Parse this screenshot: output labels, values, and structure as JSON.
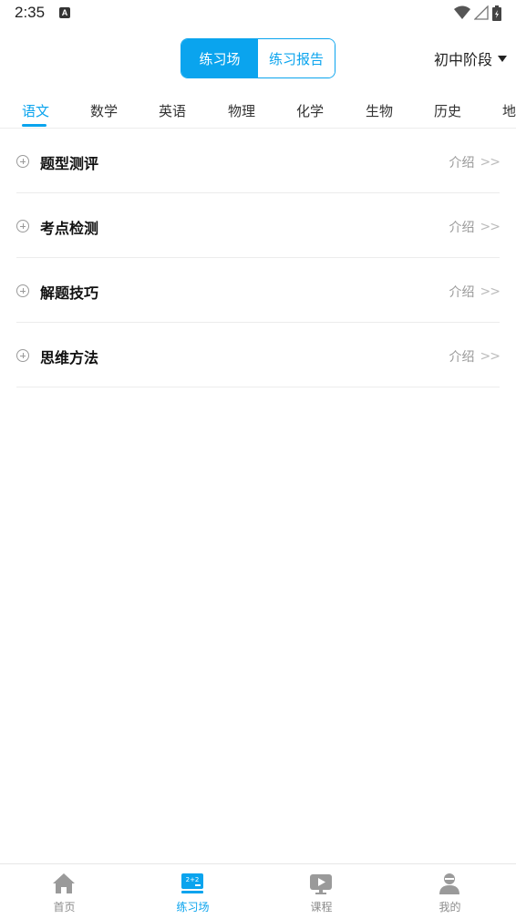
{
  "status": {
    "time": "2:35",
    "indicator": "A"
  },
  "header": {
    "segments": [
      "练习场",
      "练习报告"
    ],
    "active_segment": "练习场",
    "stage_selector": "初中阶段",
    "accent": "#0aa4ee"
  },
  "subjects": [
    "语文",
    "数学",
    "英语",
    "物理",
    "化学",
    "生物",
    "历史",
    "地"
  ],
  "active_subject": "语文",
  "list": [
    {
      "title": "题型测评",
      "intro": "介绍",
      "chevron": ">>"
    },
    {
      "title": "考点检测",
      "intro": "介绍",
      "chevron": ">>"
    },
    {
      "title": "解题技巧",
      "intro": "介绍",
      "chevron": ">>"
    },
    {
      "title": "思维方法",
      "intro": "介绍",
      "chevron": ">>"
    }
  ],
  "tabbar": [
    {
      "label": "首页",
      "icon": "home-icon"
    },
    {
      "label": "练习场",
      "icon": "blackboard-icon"
    },
    {
      "label": "课程",
      "icon": "video-icon"
    },
    {
      "label": "我的",
      "icon": "user-icon"
    }
  ],
  "active_tab": "练习场"
}
